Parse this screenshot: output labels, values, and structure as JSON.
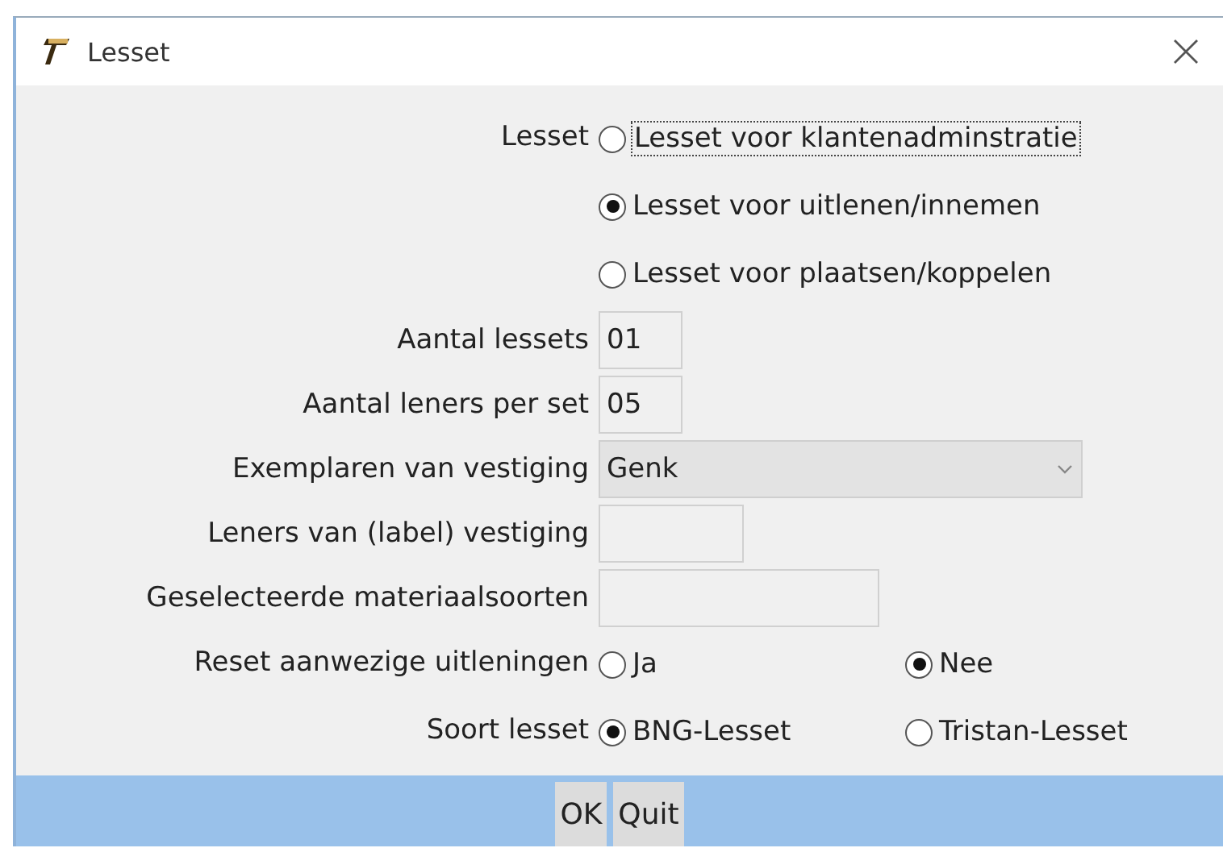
{
  "window": {
    "title": "Lesset"
  },
  "fields": [
    {
      "kind": "radio-column",
      "label": "Lesset",
      "options": [
        {
          "label": "Lesset voor klantenadminstratie",
          "selected": false,
          "focused": true
        },
        {
          "label": "Lesset voor uitlenen/innemen",
          "selected": true,
          "focused": false
        },
        {
          "label": "Lesset voor plaatsen/koppelen",
          "selected": false,
          "focused": false
        }
      ]
    },
    {
      "kind": "text",
      "label": "Aantal lessets",
      "value": "01"
    },
    {
      "kind": "text",
      "label": "Aantal leners per set",
      "value": "05"
    },
    {
      "kind": "dropdown",
      "label": "Exemplaren van vestiging",
      "value": "Genk"
    },
    {
      "kind": "text",
      "label": "Leners van (label) vestiging"
    },
    {
      "kind": "text",
      "label": "Geselecteerde materiaalsoorten"
    },
    {
      "kind": "radio-row",
      "label": "Reset aanwezige uitleningen",
      "options": [
        {
          "label": "Ja",
          "selected": false,
          "focused": false
        },
        {
          "label": "Nee",
          "selected": true,
          "focused": false
        }
      ]
    },
    {
      "kind": "radio-row",
      "label": "Soort lesset",
      "options": [
        {
          "label": "BNG-Lesset",
          "selected": true,
          "focused": false
        },
        {
          "label": "Tristan-Lesset",
          "selected": false,
          "focused": false
        }
      ]
    }
  ],
  "buttons": [
    "OK",
    "Quit"
  ]
}
